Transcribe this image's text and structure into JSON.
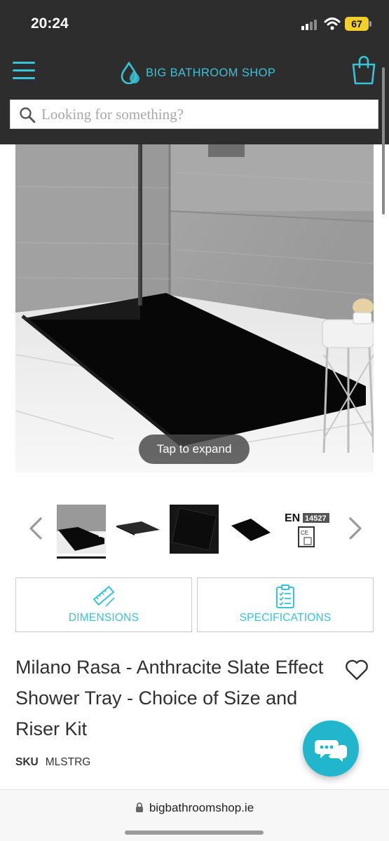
{
  "status": {
    "time": "20:24",
    "battery": "67"
  },
  "header": {
    "brand": "BIG BATHROOM SHOP"
  },
  "search": {
    "placeholder": "Looking for something?"
  },
  "gallery": {
    "expand_hint": "Tap to expand",
    "certification": {
      "mark": "EN",
      "code": "14527"
    }
  },
  "features": {
    "dimensions": "DIMENSIONS",
    "specifications": "SPECIFICATIONS"
  },
  "product": {
    "title": "Milano Rasa - Anthracite Slate Effect Shower Tray - Choice of Size and Riser Kit",
    "sku_label": "SKU",
    "sku": "MLSTRG"
  },
  "browser": {
    "url": "bigbathroomshop.ie"
  },
  "colors": {
    "brand_accent": "#39c3d6",
    "header_bg": "#2d2d2d",
    "chat_button": "#22b6cc"
  },
  "icons": [
    "menu-icon",
    "droplet-logo-icon",
    "shopping-bag-icon",
    "search-icon",
    "chevron-left-icon",
    "chevron-right-icon",
    "ruler-icon",
    "clipboard-checklist-icon",
    "heart-icon",
    "chat-bubbles-icon",
    "lock-icon"
  ]
}
